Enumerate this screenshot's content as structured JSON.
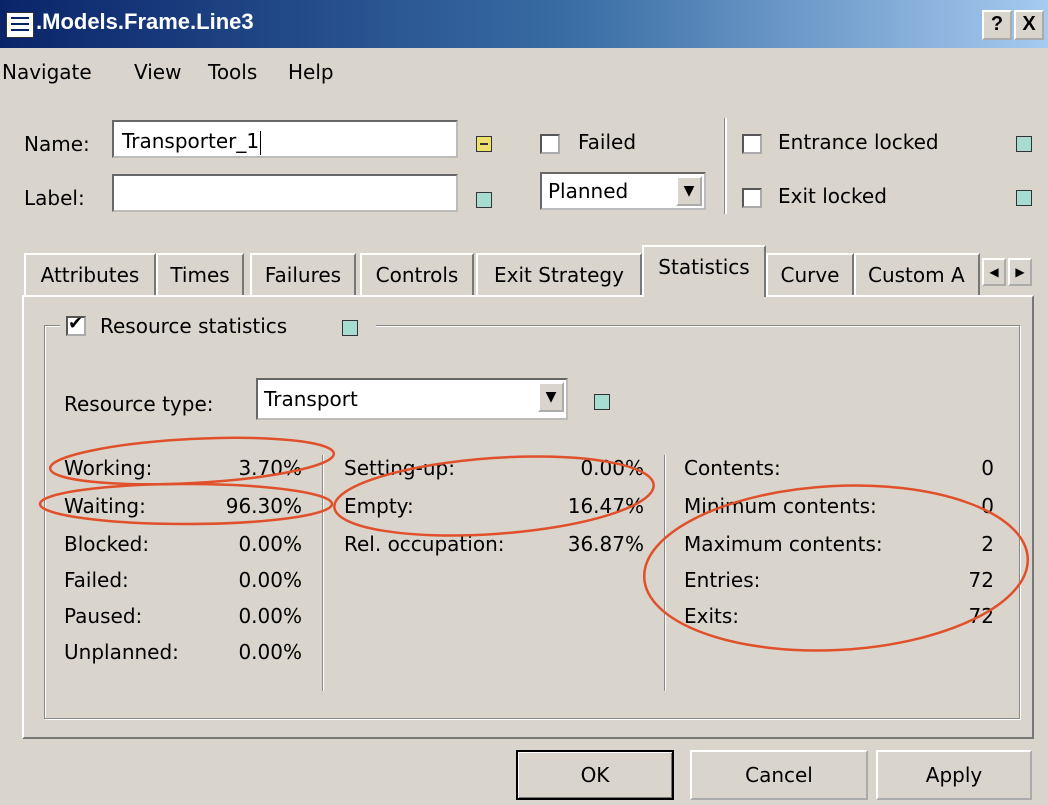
{
  "window": {
    "title": ".Models.Frame.Line3",
    "help_label": "?",
    "close_label": "X"
  },
  "menu": [
    "Navigate",
    "View",
    "Tools",
    "Help"
  ],
  "form": {
    "name_label": "Name:",
    "name_value": "Transporter_1",
    "label_label": "Label:",
    "label_value": "",
    "failed_label": "Failed",
    "failed_checked": false,
    "planned_value": "Planned",
    "entrance_locked_label": "Entrance locked",
    "entrance_locked_checked": false,
    "exit_locked_label": "Exit locked",
    "exit_locked_checked": false
  },
  "tabs": [
    "Attributes",
    "Times",
    "Failures",
    "Controls",
    "Exit Strategy",
    "Statistics",
    "Curve",
    "Custom A"
  ],
  "active_tab": "Statistics",
  "statistics": {
    "resource_statistics_label": "Resource statistics",
    "resource_statistics_checked": true,
    "resource_type_label": "Resource type:",
    "resource_type_value": "Transport",
    "col1": [
      {
        "label": "Working:",
        "value": "3.70%"
      },
      {
        "label": "Waiting:",
        "value": "96.30%"
      },
      {
        "label": "Blocked:",
        "value": "0.00%"
      },
      {
        "label": "Failed:",
        "value": "0.00%"
      },
      {
        "label": "Paused:",
        "value": "0.00%"
      },
      {
        "label": "Unplanned:",
        "value": "0.00%"
      }
    ],
    "col2": [
      {
        "label": "Setting-up:",
        "value": "0.00%"
      },
      {
        "label": "Empty:",
        "value": "16.47%"
      },
      {
        "label": "Rel. occupation:",
        "value": "36.87%"
      }
    ],
    "col3": [
      {
        "label": "Contents:",
        "value": "0"
      },
      {
        "label": "Minimum contents:",
        "value": "0"
      },
      {
        "label": "Maximum contents:",
        "value": "2"
      },
      {
        "label": "Entries:",
        "value": "72"
      },
      {
        "label": "Exits:",
        "value": "72"
      }
    ]
  },
  "buttons": {
    "ok": "OK",
    "cancel": "Cancel",
    "apply": "Apply"
  },
  "colors": {
    "annotation": "#e0502a",
    "title_bar": "#0a246a",
    "indicator": "#a7ddd0"
  }
}
